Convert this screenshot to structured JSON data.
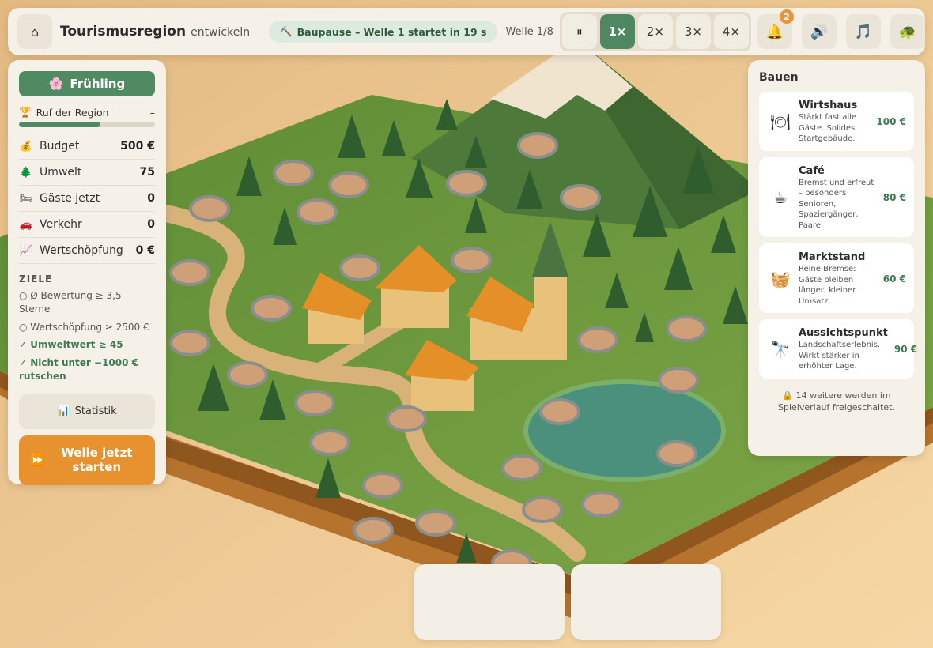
{
  "header": {
    "home_icon": "home-icon",
    "title": "Tourismusregion",
    "subtitle": "entwickeln",
    "phase_icon": "hammer-icon",
    "phase_text": "Baupause – Welle 1 startet in 19 s",
    "wave_label": "Welle 1/8",
    "speed": {
      "pause": "⏸",
      "x1": "1×",
      "x2": "2×",
      "x3": "3×",
      "x4": "4×",
      "active": "1×"
    },
    "notification_count": "2"
  },
  "sidebar": {
    "season_label": "Frühling",
    "reputation_label": "Ruf der Region",
    "reputation_value": "–",
    "reputation_progress": 0.6,
    "stats": [
      {
        "label": "Budget",
        "value": "500 €",
        "icon": "money-bag-icon"
      },
      {
        "label": "Umwelt",
        "value": "75",
        "icon": "tree-icon"
      },
      {
        "label": "Gäste jetzt",
        "value": "0",
        "icon": "bed-icon"
      },
      {
        "label": "Verkehr",
        "value": "0",
        "icon": "car-icon"
      },
      {
        "label": "Wertschöpfung",
        "value": "0 €",
        "icon": "chart-icon"
      }
    ],
    "goals_title": "ZIELE",
    "goals": [
      {
        "text": "○ Ø Bewertung ≥ 3,5 Sterne",
        "done": false
      },
      {
        "text": "○ Wertschöpfung ≥ 2500 €",
        "done": false
      },
      {
        "text": "✓ Umweltwert ≥ 45",
        "done": true
      },
      {
        "text": "✓ Nicht unter −1000 € rutschen",
        "done": true
      }
    ],
    "stats_button": "Statistik",
    "wave_button": "Welle jetzt starten"
  },
  "build": {
    "title": "Bauen",
    "items": [
      {
        "name": "Wirtshaus",
        "desc": "Stärkt fast alle Gäste. Solides Startgebäude.",
        "price": "100 €",
        "icon": "fork-knife-icon"
      },
      {
        "name": "Café",
        "desc": "Bremst und erfreut – besonders Senioren, Spaziergänger, Paare.",
        "price": "80 €",
        "icon": "coffee-icon"
      },
      {
        "name": "Marktstand",
        "desc": "Reine Bremse: Gäste bleiben länger, kleiner Umsatz.",
        "price": "60 €",
        "icon": "basket-icon"
      },
      {
        "name": "Aussichtspunkt",
        "desc": "Landschaftserlebnis. Wirkt stärker in erhöhter Lage.",
        "price": "90 €",
        "icon": "telescope-icon"
      }
    ],
    "unlock_note": "14 weitere werden im Spielverlauf freigeschaltet."
  },
  "colors": {
    "accent": "#508a63",
    "orange": "#e8912f",
    "panel": "#f5f1e8",
    "grass": "#6f9a3c"
  }
}
